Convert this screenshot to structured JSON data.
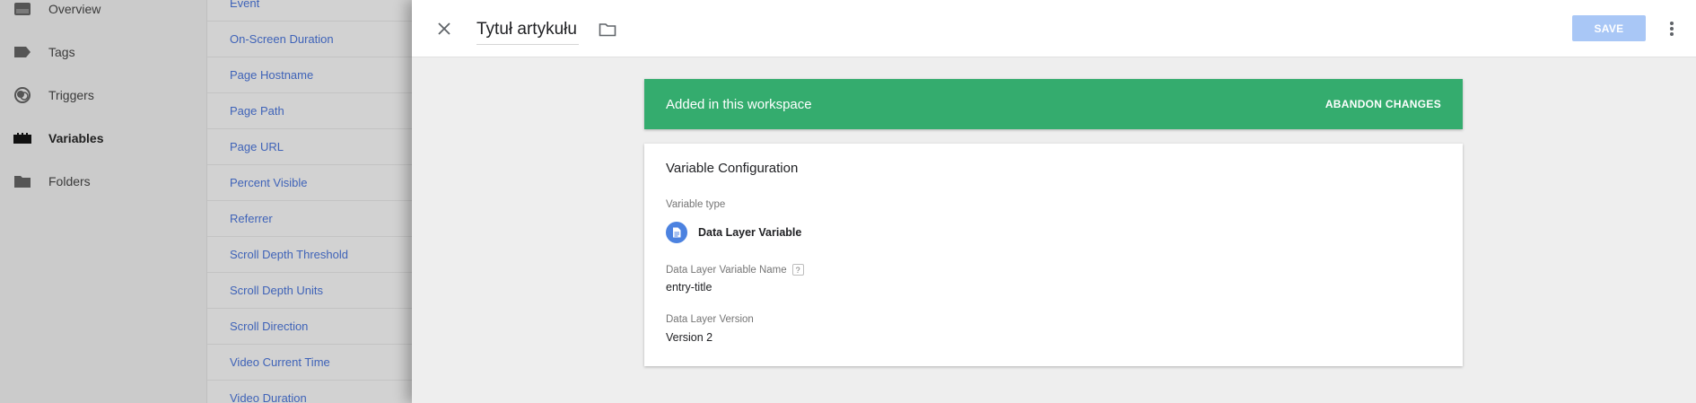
{
  "nav": {
    "items": [
      {
        "label": "Overview",
        "icon": "overview-icon"
      },
      {
        "label": "Tags",
        "icon": "tag-icon"
      },
      {
        "label": "Triggers",
        "icon": "trigger-icon"
      },
      {
        "label": "Variables",
        "icon": "variables-icon",
        "active": true
      },
      {
        "label": "Folders",
        "icon": "folder-icon"
      }
    ]
  },
  "variables_list": {
    "items": [
      "Event",
      "On-Screen Duration",
      "Page Hostname",
      "Page Path",
      "Page URL",
      "Percent Visible",
      "Referrer",
      "Scroll Depth Threshold",
      "Scroll Depth Units",
      "Scroll Direction",
      "Video Current Time",
      "Video Duration"
    ]
  },
  "header": {
    "title": "Tytuł artykułu",
    "save_label": "SAVE"
  },
  "banner": {
    "text": "Added in this workspace",
    "action_label": "ABANDON CHANGES",
    "color": "#34ac6e"
  },
  "config": {
    "title": "Variable Configuration",
    "type_label": "Variable type",
    "type_name": "Data Layer Variable",
    "type_icon_color": "#4c82e0",
    "name_label": "Data Layer Variable Name",
    "help_glyph": "?",
    "name_value": "entry-title",
    "version_label": "Data Layer Version",
    "version_value": "Version 2"
  },
  "colors": {
    "link": "#3f63b8",
    "save_disabled": "#a9c7f6"
  }
}
